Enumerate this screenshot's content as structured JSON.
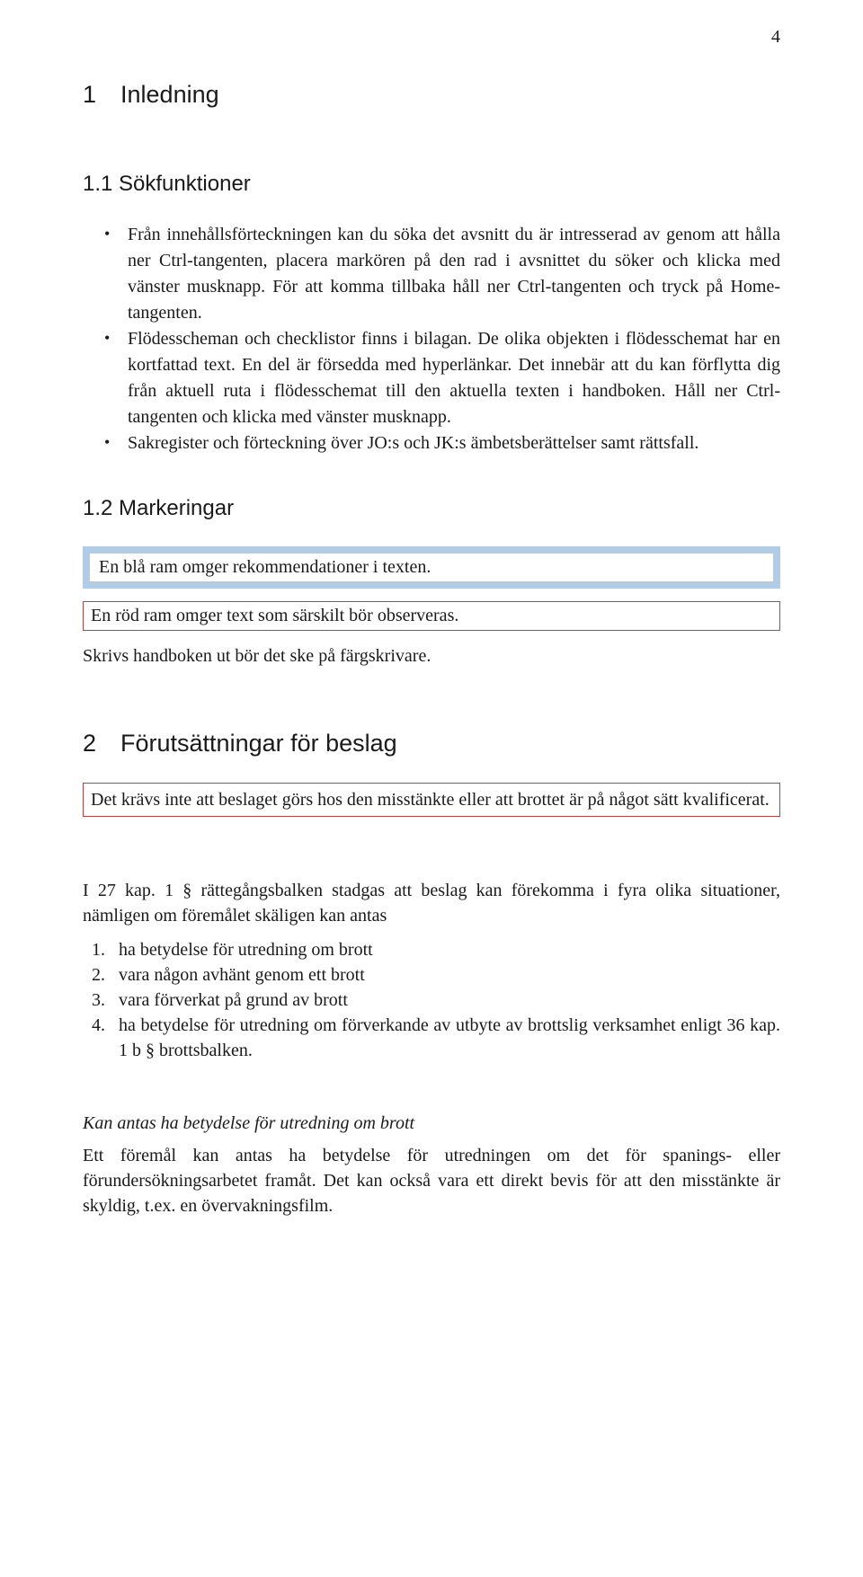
{
  "page_number": "4",
  "section1": {
    "heading": "1 Inledning",
    "sub1": {
      "heading": "1.1 Sökfunktioner",
      "bullets": [
        "Från innehållsförteckningen kan du söka det avsnitt du är intresserad av genom att hålla ner Ctrl-tangenten, placera markören på den rad i avsnittet du söker och klicka med vänster musknapp. För att komma tillbaka håll ner Ctrl-tangenten och tryck på Home-tangenten.",
        "Flödesscheman och checklistor finns i bilagan. De olika objekten i flödesschemat har en kortfattad text. En del är försedda med hyperlänkar. Det innebär att du kan förflytta dig från aktuell ruta i flödesschemat till den aktuella texten i handboken. Håll ner Ctrl-tangenten och klicka med vänster musknapp.",
        "Sakregister och förteckning över JO:s och JK:s ämbetsberättelser samt rättsfall."
      ]
    },
    "sub2": {
      "heading": "1.2 Markeringar",
      "blue_box": "En blå ram omger rekommendationer i texten.",
      "red_box": "En röd ram omger text som särskilt bör observeras.",
      "note": "Skrivs handboken ut bör det ske på färgskrivare."
    }
  },
  "section2": {
    "heading": "2 Förutsättningar för beslag",
    "red_box": "Det krävs inte att beslaget görs hos den misstänkte eller att brottet är på något sätt kvalificerat.",
    "intro": "I 27 kap. 1 § rättegångsbalken stadgas att beslag kan förekomma i fyra olika situationer, nämligen om föremålet skäligen kan antas",
    "items": [
      "ha betydelse för utredning om brott",
      "vara någon avhänt genom ett brott",
      "vara förverkat på grund av brott",
      "ha betydelse för utredning om förverkande av utbyte av brottslig verksamhet enligt 36 kap. 1 b § brottsbalken."
    ],
    "sub": {
      "heading": "Kan antas ha betydelse för utredning om brott",
      "para": "Ett föremål kan antas ha betydelse för utredningen om det för spanings- eller förundersökningsarbetet framåt. Det kan också vara ett direkt bevis för att den misstänkte är skyldig, t.ex. en övervakningsfilm."
    }
  }
}
